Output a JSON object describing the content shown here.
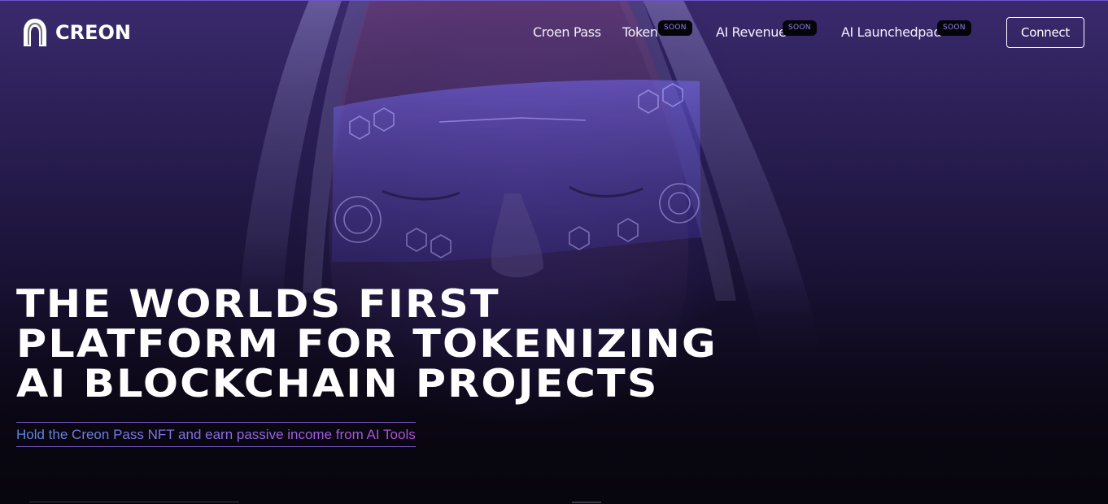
{
  "brand": {
    "name": "CREON",
    "logo_icon": "creon-arch-icon"
  },
  "nav": {
    "items": [
      {
        "label": "Croen Pass",
        "badge": ""
      },
      {
        "label": "Token",
        "badge": "SOON"
      },
      {
        "label": "AI Revenue",
        "badge": "SOON"
      },
      {
        "label": "AI Launchedpad",
        "badge": "SOON"
      }
    ],
    "connect_label": "Connect"
  },
  "hero": {
    "headline_lines": [
      "THE WORLDS FIRST",
      "PLATFORM FOR TOKENIZING",
      "AI BLOCKCHAIN PROJECTS"
    ],
    "subtitle": "Hold the Creon Pass NFT and earn passive income from AI Tools",
    "background_image": "woman-with-holographic-visor"
  },
  "colors": {
    "accent_purple": "#7c5ccf",
    "badge_text": "#8e84e8",
    "subtitle_start": "#5d88e0",
    "subtitle_end": "#b04fdc"
  }
}
